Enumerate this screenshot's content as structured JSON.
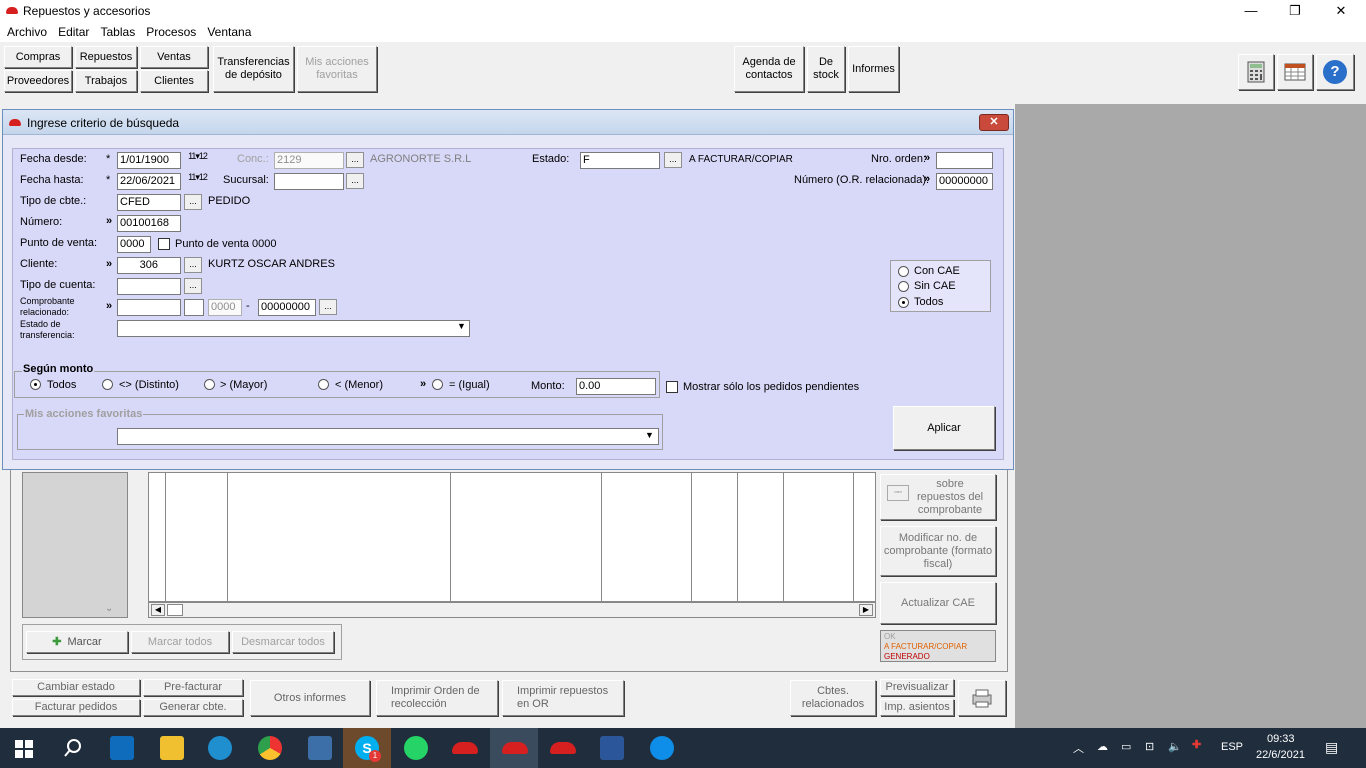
{
  "window": {
    "title": "Repuestos y accesorios",
    "minimize": "—",
    "maximize": "❐",
    "close": "✕"
  },
  "menu": [
    "Archivo",
    "Editar",
    "Tablas",
    "Procesos",
    "Ventana"
  ],
  "toolbar": {
    "compras": "Compras",
    "repuestos": "Repuestos",
    "ventas": "Ventas",
    "proveedores": "Proveedores",
    "trabajos": "Trabajos",
    "clientes": "Clientes",
    "transferencias": "Transferencias de depósito",
    "mis_acciones": "Mis acciones favoritas",
    "agenda": "Agenda de contactos",
    "destock": "De stock",
    "informes": "Informes",
    "help": "?"
  },
  "dialog": {
    "title": "Ingrese criterio de búsqueda",
    "close": "✕",
    "fecha_desde_label": "Fecha desde:",
    "fecha_desde": "1/01/1900",
    "fecha_hasta_label": "Fecha hasta:",
    "fecha_hasta": "22/06/2021",
    "conc_label": "Conc.:",
    "conc_value": "2129",
    "conc_name": "AGRONORTE S.R.L",
    "sucursal_label": "Sucursal:",
    "sucursal_value": "",
    "estado_label": "Estado:",
    "estado_value": "F",
    "estado_desc": "A FACTURAR/COPIAR",
    "nro_orden_label": "Nro. orden:",
    "nro_orden": "",
    "numero_or_label": "Número (O.R. relacionada):",
    "numero_or": "00000000",
    "tipo_cbte_label": "Tipo de cbte.:",
    "tipo_cbte": "CFED",
    "tipo_cbte_desc": "PEDIDO",
    "numero_label": "Número:",
    "numero": "00100168",
    "punto_venta_label": "Punto de venta:",
    "punto_venta": "0000",
    "punto_venta_0000": "Punto de venta 0000",
    "cliente_label": "Cliente:",
    "cliente": "306",
    "cliente_name": "KURTZ OSCAR ANDRES",
    "tipo_cuenta_label": "Tipo de cuenta:",
    "tipo_cuenta": "",
    "comp_rel_label": "Comprobante relacionado:",
    "comp_rel_a": "",
    "comp_rel_b": "",
    "comp_rel_c": "0000",
    "comp_rel_dash": "-",
    "comp_rel_d": "00000000",
    "estado_transf_label": "Estado de transferencia:",
    "estado_transf": "",
    "cae_options": [
      "Con CAE",
      "Sin CAE",
      "Todos"
    ],
    "cae_selected": "Todos",
    "monto_group": "Según monto",
    "monto_options": [
      "Todos",
      "<> (Distinto)",
      "> (Mayor)",
      "< (Menor)",
      "= (Igual)"
    ],
    "monto_label": "Monto:",
    "monto": "0.00",
    "pendientes_label": "Mostrar sólo los pedidos pendientes",
    "mis_acciones_group": "Mis acciones favoritas",
    "aplicar": "Aplicar",
    "ellipsis": "...",
    "star": "*",
    "arrow": "»",
    "cal_icon_text": "11▾12"
  },
  "right_panel": {
    "sobre_repuestos": "sobre repuestos del comprobante",
    "modificar": "Modificar no. de comprobante (formato fiscal)",
    "actualizar_cae": "Actualizar CAE",
    "legend_ok": "OK",
    "legend_facturar": "A FACTURAR/COPIAR",
    "legend_generado": "GENERADO",
    "legend_colors": {
      "ok": "#a0a0a0",
      "facturar": "#e06000",
      "generado": "#c00000"
    }
  },
  "grid_buttons": {
    "marcar": "Marcar",
    "marcar_todos": "Marcar todos",
    "desmarcar_todos": "Desmarcar todos"
  },
  "bottom": {
    "cambiar_estado": "Cambiar estado",
    "pre_facturar": "Pre-facturar",
    "facturar_pedidos": "Facturar pedidos",
    "generar_cbte": "Generar cbte.",
    "otros_informes": "Otros informes",
    "imprimir_orden": "Imprimir Orden de recolección",
    "imprimir_repuestos": "Imprimir repuestos en OR",
    "cbtes_relacionados": "Cbtes. relacionados",
    "previsualizar": "Previsualizar",
    "imp_asientos": "Imp. asientos"
  },
  "taskbar": {
    "lang": "ESP",
    "time": "09:33",
    "date": "22/6/2021",
    "skype_badge": "1",
    "tray_badge": "1"
  }
}
